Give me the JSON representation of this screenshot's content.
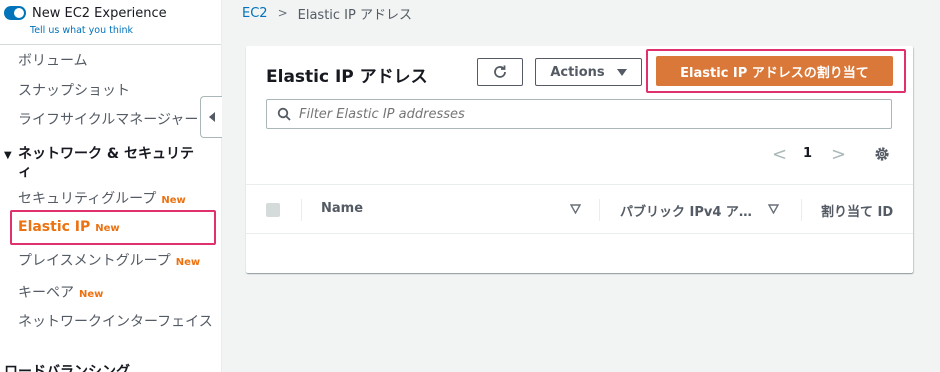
{
  "sidebar": {
    "experience_toggle_label": "New EC2 Experience",
    "feedback_link": "Tell us what you think",
    "items": [
      {
        "label": "ボリューム",
        "badge": ""
      },
      {
        "label": "スナップショット",
        "badge": ""
      },
      {
        "label": "ライフサイクルマネージャー",
        "badge": ""
      }
    ],
    "section_header": "ネットワーク & セキュリティ",
    "network_items": [
      {
        "label": "セキュリティグループ",
        "badge": "New"
      },
      {
        "label": "Elastic IP",
        "badge": "New"
      },
      {
        "label": "プレイスメントグループ",
        "badge": "New"
      },
      {
        "label": "キーペア",
        "badge": "New"
      },
      {
        "label": "ネットワークインターフェイス",
        "badge": ""
      }
    ],
    "next_section_header": "ロードバランシング"
  },
  "breadcrumb": {
    "root": "EC2",
    "current": "Elastic IP アドレス"
  },
  "main": {
    "title": "Elastic IP アドレス",
    "actions_label": "Actions",
    "allocate_label": "Elastic IP アドレスの割り当て",
    "filter_placeholder": "Filter Elastic IP addresses",
    "pagination": {
      "current_page": "1"
    },
    "table": {
      "columns": [
        "Name",
        "パブリック IPv4 ア…",
        "割り当て ID"
      ]
    }
  },
  "colors": {
    "accent": "#0073bb",
    "primary_button": "#d97839",
    "badge": "#ec7211",
    "highlight": "#e0306e"
  },
  "icons": {
    "toggle": "toggle-switch-icon",
    "collapse": "collapse-left-icon",
    "refresh": "refresh-icon",
    "dropdown": "caret-down-icon",
    "search": "search-icon",
    "prev": "chevron-left-icon",
    "next": "chevron-right-icon",
    "settings": "gear-icon",
    "sort": "sort-icon"
  }
}
